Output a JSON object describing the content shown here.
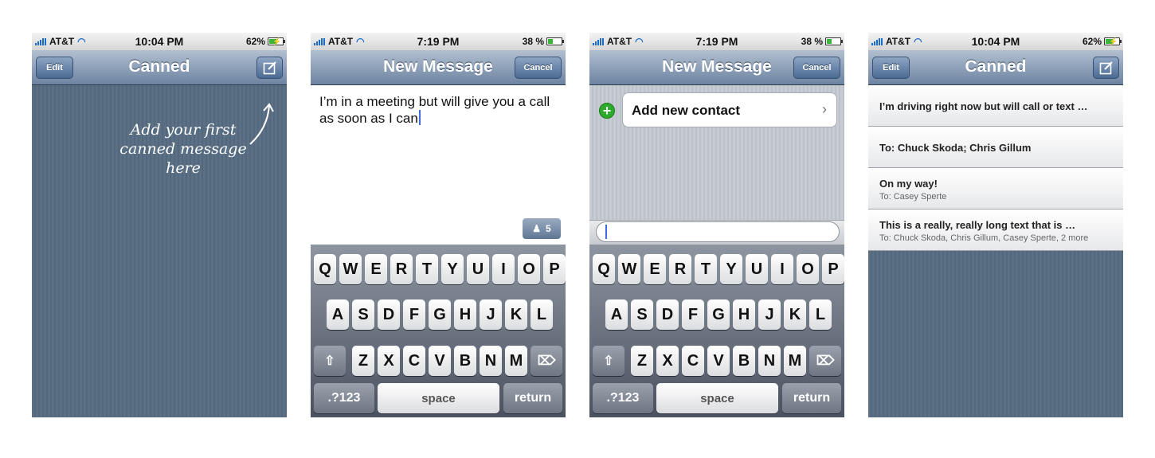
{
  "status": [
    {
      "carrier": "AT&T",
      "time": "10:04 PM",
      "battery": "62%",
      "battery_level": 0.62
    },
    {
      "carrier": "AT&T",
      "time": "7:19 PM",
      "battery": "38 %",
      "battery_level": 0.38
    },
    {
      "carrier": "AT&T",
      "time": "7:19 PM",
      "battery": "38 %",
      "battery_level": 0.38
    },
    {
      "carrier": "AT&T",
      "time": "10:04 PM",
      "battery": "62%",
      "battery_level": 0.62
    }
  ],
  "screen1": {
    "edit": "Edit",
    "title": "Canned",
    "compose_icon": "compose-icon",
    "hint": "Add your first canned message here"
  },
  "screen2": {
    "title": "New Message",
    "cancel": "Cancel",
    "message": "I’m in a meeting but will give you a call as soon as I can",
    "recipient_count": "5"
  },
  "screen3": {
    "title": "New Message",
    "cancel": "Cancel",
    "add_contact": "Add new contact"
  },
  "screen4": {
    "edit": "Edit",
    "title": "Canned",
    "messages": [
      {
        "text": "I’m driving right now but will call or text …",
        "to": ""
      },
      {
        "text": "To: Chuck Skoda; Chris Gillum",
        "to": ""
      },
      {
        "text": "On my way!",
        "to": "To: Casey Sperte"
      },
      {
        "text": "This is a really, really long text that is …",
        "to": "To: Chuck Skoda, Chris Gillum, Casey Sperte, 2 more"
      }
    ]
  },
  "keyboard": {
    "row1": [
      "Q",
      "W",
      "E",
      "R",
      "T",
      "Y",
      "U",
      "I",
      "O",
      "P"
    ],
    "row2": [
      "A",
      "S",
      "D",
      "F",
      "G",
      "H",
      "J",
      "K",
      "L"
    ],
    "row3": [
      "Z",
      "X",
      "C",
      "V",
      "B",
      "N",
      "M"
    ],
    "numbers": ".?123",
    "space": "space",
    "return": "return"
  }
}
